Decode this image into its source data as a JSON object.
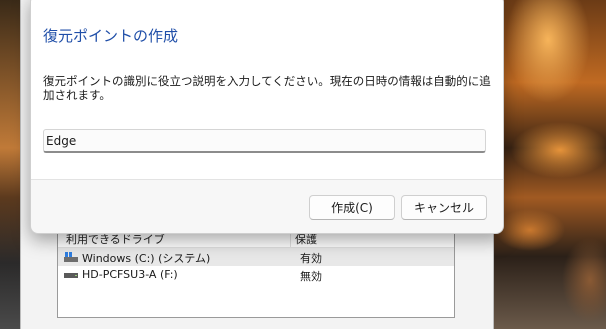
{
  "background_window": {
    "list_header": {
      "drive_col": "利用できるドライブ",
      "protection_col": "保護"
    },
    "drives": [
      {
        "name": "Windows (C:) (システム)",
        "state": "有効",
        "icon": "system-drive-icon"
      },
      {
        "name": "HD-PCFSU3-A (F:)",
        "state": "無効",
        "icon": "drive-icon"
      }
    ]
  },
  "dialog": {
    "title": "復元ポイントの作成",
    "description": "復元ポイントの識別に役立つ説明を入力してください。現在の日時の情報は自動的に追加されます。",
    "input_value": "Edge",
    "create_button": "作成(C)",
    "cancel_button": "キャンセル",
    "accent_color": "#1f4ea8"
  }
}
